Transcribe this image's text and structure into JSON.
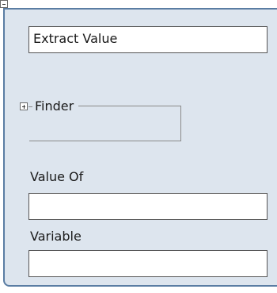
{
  "block": {
    "title": "Extract Value",
    "finder": {
      "label": "Finder"
    },
    "value_of": {
      "label": "Value Of",
      "value": ""
    },
    "variable": {
      "label": "Variable",
      "value": ""
    }
  },
  "icons": {
    "collapse": "minus-box-icon",
    "expand": "plus-box-icon"
  }
}
